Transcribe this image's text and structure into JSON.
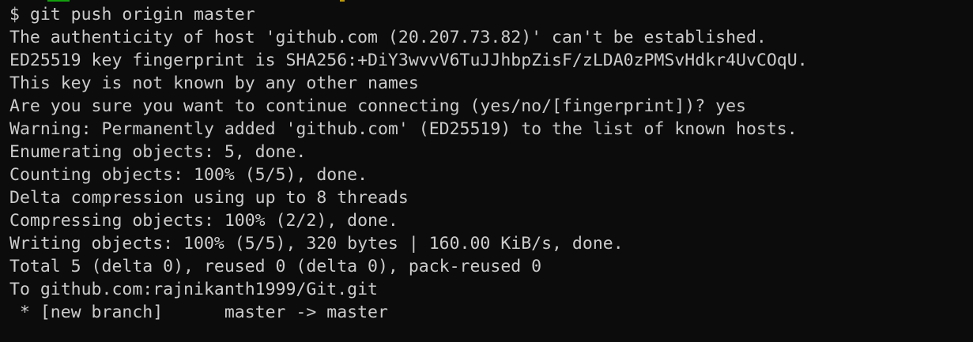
{
  "theme": {
    "background": "#0c0c0c",
    "foreground": "#cccccc",
    "top_strip_colors": [
      "#13a10e",
      "#c19c00"
    ]
  },
  "terminal": {
    "lines": [
      "$ git push origin master",
      "The authenticity of host 'github.com (20.207.73.82)' can't be established.",
      "ED25519 key fingerprint is SHA256:+DiY3wvvV6TuJJhbpZisF/zLDA0zPMSvHdkr4UvCOqU.",
      "This key is not known by any other names",
      "Are you sure you want to continue connecting (yes/no/[fingerprint])? yes",
      "Warning: Permanently added 'github.com' (ED25519) to the list of known hosts.",
      "Enumerating objects: 5, done.",
      "Counting objects: 100% (5/5), done.",
      "Delta compression using up to 8 threads",
      "Compressing objects: 100% (2/2), done.",
      "Writing objects: 100% (5/5), 320 bytes | 160.00 KiB/s, done.",
      "Total 5 (delta 0), reused 0 (delta 0), pack-reused 0",
      "To github.com:rajnikanth1999/Git.git",
      " * [new branch]      master -> master"
    ]
  }
}
